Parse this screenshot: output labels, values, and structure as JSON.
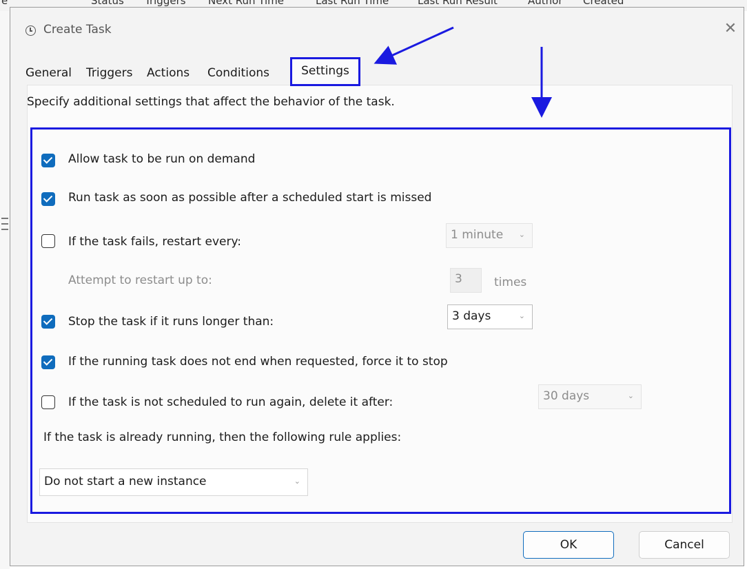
{
  "background": {
    "header_fragments": [
      "e",
      "Status",
      "Triggers",
      "Next Run Time",
      "Last Run Time",
      "Last Run Result",
      "Author",
      "Created"
    ]
  },
  "dialog": {
    "title": "Create Task",
    "close_label": "✕"
  },
  "tabs": [
    {
      "label": "General"
    },
    {
      "label": "Triggers"
    },
    {
      "label": "Actions"
    },
    {
      "label": "Conditions"
    },
    {
      "label": "Settings",
      "selected": true
    }
  ],
  "settings": {
    "description": "Specify additional settings that affect the behavior of the task.",
    "allow_on_demand": {
      "label": "Allow task to be run on demand",
      "checked": true
    },
    "run_after_missed": {
      "label": "Run task as soon as possible after a scheduled start is missed",
      "checked": true
    },
    "restart_on_fail": {
      "label": "If the task fails, restart every:",
      "checked": false,
      "interval": "1 minute"
    },
    "restart_attempts": {
      "label": "Attempt to restart up to:",
      "value": "3",
      "unit": "times"
    },
    "stop_if_longer": {
      "label": "Stop the task if it runs longer than:",
      "checked": true,
      "value": "3 days"
    },
    "force_stop": {
      "label": "If the running task does not end when requested, force it to stop",
      "checked": true
    },
    "delete_after": {
      "label": "If the task is not scheduled to run again, delete it after:",
      "checked": false,
      "value": "30 days"
    },
    "rule_label": "If the task is already running, then the following rule applies:",
    "rule_value": "Do not start a new instance"
  },
  "buttons": {
    "ok": "OK",
    "cancel": "Cancel"
  },
  "colors": {
    "accent": "#0f6cbd",
    "annotation": "#1a1ae0"
  },
  "icons": {
    "title": "clock-icon",
    "dropdown": "chevron-down-icon"
  }
}
